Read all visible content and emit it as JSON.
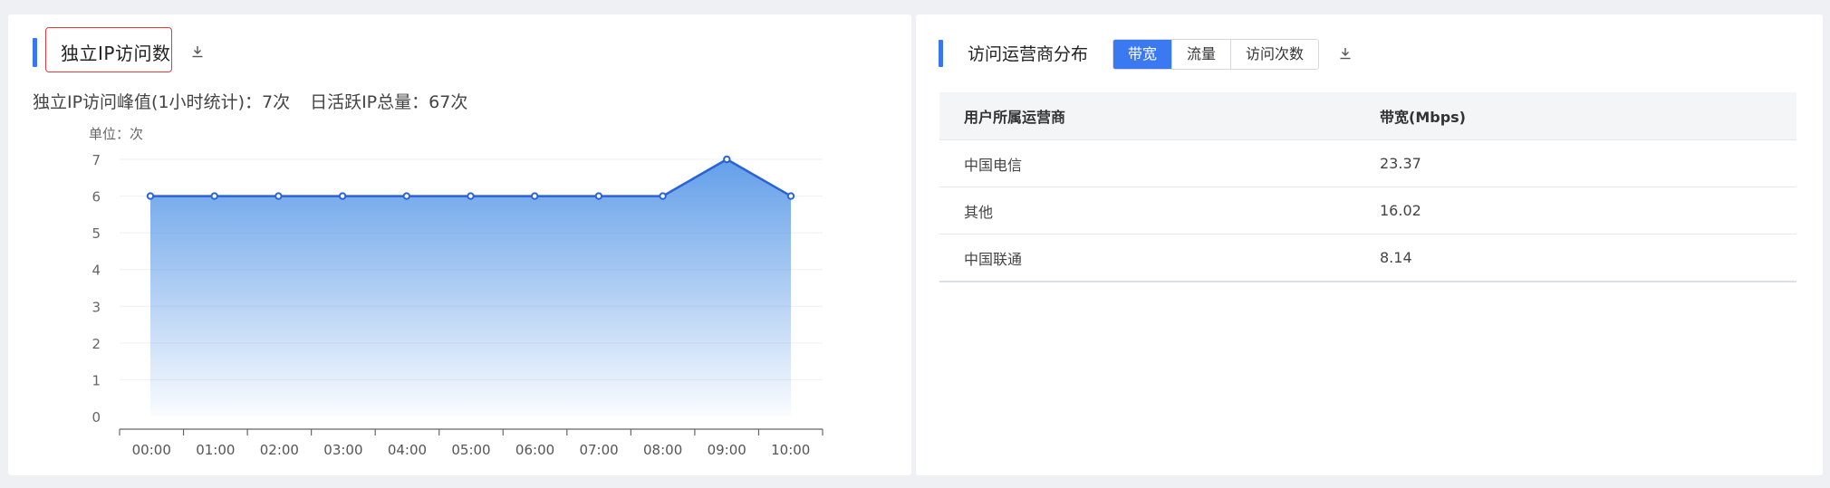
{
  "left_panel": {
    "title": "独立IP访问数",
    "stats": {
      "peak_label": "独立IP访问峰值(1小时统计)：",
      "peak_value": "7次",
      "daily_label": "日活跃IP总量：",
      "daily_value": "67次"
    }
  },
  "chart_data": {
    "type": "area",
    "unit_label": "单位：次",
    "categories": [
      "00:00",
      "01:00",
      "02:00",
      "03:00",
      "04:00",
      "05:00",
      "06:00",
      "07:00",
      "08:00",
      "09:00",
      "10:00"
    ],
    "values": [
      6,
      6,
      6,
      6,
      6,
      6,
      6,
      6,
      6,
      7,
      6
    ],
    "yticks": [
      0,
      1,
      2,
      3,
      4,
      5,
      6,
      7
    ],
    "ylim": [
      0,
      7
    ],
    "line_color": "#2a62d8",
    "fill_color": "#5b9ae8"
  },
  "right_panel": {
    "title": "访问运营商分布",
    "tabs": [
      {
        "label": "带宽",
        "active": true
      },
      {
        "label": "流量",
        "active": false
      },
      {
        "label": "访问次数",
        "active": false
      }
    ],
    "table": {
      "headers": [
        "用户所属运营商",
        "带宽(Mbps)"
      ],
      "rows": [
        [
          "中国电信",
          "23.37"
        ],
        [
          "其他",
          "16.02"
        ],
        [
          "中国联通",
          "8.14"
        ]
      ]
    }
  },
  "colors": {
    "accent": "#3a76f0",
    "highlight_border": "#e23c3c"
  },
  "icons": [
    "download-icon"
  ]
}
